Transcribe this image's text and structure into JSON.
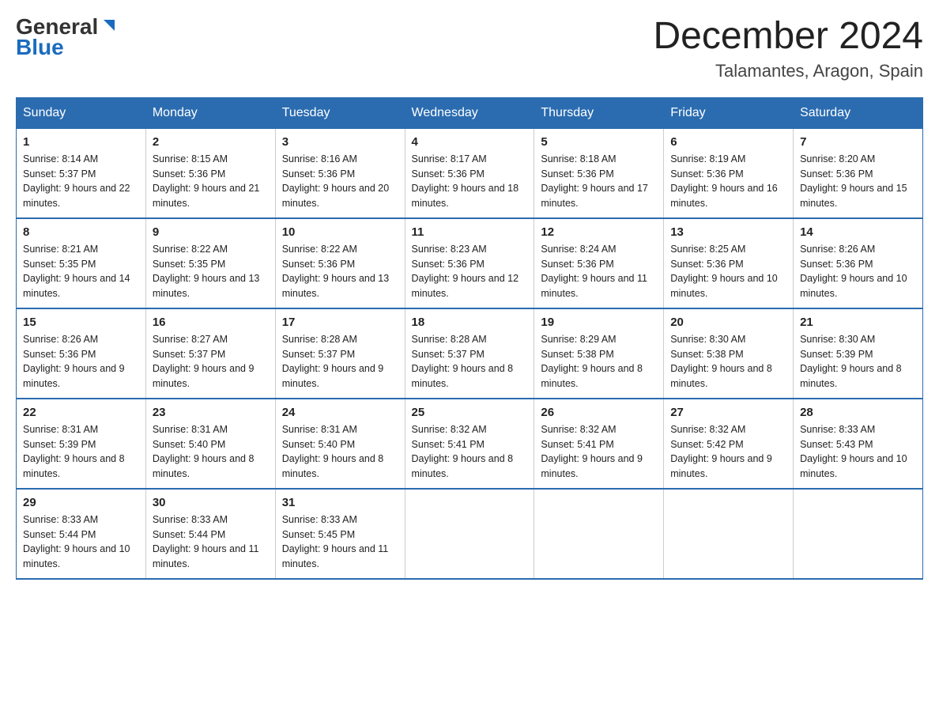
{
  "logo": {
    "part1": "General",
    "part2": "Blue"
  },
  "header": {
    "month": "December 2024",
    "location": "Talamantes, Aragon, Spain"
  },
  "weekdays": [
    "Sunday",
    "Monday",
    "Tuesday",
    "Wednesday",
    "Thursday",
    "Friday",
    "Saturday"
  ],
  "weeks": [
    [
      {
        "day": "1",
        "sunrise": "8:14 AM",
        "sunset": "5:37 PM",
        "daylight": "9 hours and 22 minutes."
      },
      {
        "day": "2",
        "sunrise": "8:15 AM",
        "sunset": "5:36 PM",
        "daylight": "9 hours and 21 minutes."
      },
      {
        "day": "3",
        "sunrise": "8:16 AM",
        "sunset": "5:36 PM",
        "daylight": "9 hours and 20 minutes."
      },
      {
        "day": "4",
        "sunrise": "8:17 AM",
        "sunset": "5:36 PM",
        "daylight": "9 hours and 18 minutes."
      },
      {
        "day": "5",
        "sunrise": "8:18 AM",
        "sunset": "5:36 PM",
        "daylight": "9 hours and 17 minutes."
      },
      {
        "day": "6",
        "sunrise": "8:19 AM",
        "sunset": "5:36 PM",
        "daylight": "9 hours and 16 minutes."
      },
      {
        "day": "7",
        "sunrise": "8:20 AM",
        "sunset": "5:36 PM",
        "daylight": "9 hours and 15 minutes."
      }
    ],
    [
      {
        "day": "8",
        "sunrise": "8:21 AM",
        "sunset": "5:35 PM",
        "daylight": "9 hours and 14 minutes."
      },
      {
        "day": "9",
        "sunrise": "8:22 AM",
        "sunset": "5:35 PM",
        "daylight": "9 hours and 13 minutes."
      },
      {
        "day": "10",
        "sunrise": "8:22 AM",
        "sunset": "5:36 PM",
        "daylight": "9 hours and 13 minutes."
      },
      {
        "day": "11",
        "sunrise": "8:23 AM",
        "sunset": "5:36 PM",
        "daylight": "9 hours and 12 minutes."
      },
      {
        "day": "12",
        "sunrise": "8:24 AM",
        "sunset": "5:36 PM",
        "daylight": "9 hours and 11 minutes."
      },
      {
        "day": "13",
        "sunrise": "8:25 AM",
        "sunset": "5:36 PM",
        "daylight": "9 hours and 10 minutes."
      },
      {
        "day": "14",
        "sunrise": "8:26 AM",
        "sunset": "5:36 PM",
        "daylight": "9 hours and 10 minutes."
      }
    ],
    [
      {
        "day": "15",
        "sunrise": "8:26 AM",
        "sunset": "5:36 PM",
        "daylight": "9 hours and 9 minutes."
      },
      {
        "day": "16",
        "sunrise": "8:27 AM",
        "sunset": "5:37 PM",
        "daylight": "9 hours and 9 minutes."
      },
      {
        "day": "17",
        "sunrise": "8:28 AM",
        "sunset": "5:37 PM",
        "daylight": "9 hours and 9 minutes."
      },
      {
        "day": "18",
        "sunrise": "8:28 AM",
        "sunset": "5:37 PM",
        "daylight": "9 hours and 8 minutes."
      },
      {
        "day": "19",
        "sunrise": "8:29 AM",
        "sunset": "5:38 PM",
        "daylight": "9 hours and 8 minutes."
      },
      {
        "day": "20",
        "sunrise": "8:30 AM",
        "sunset": "5:38 PM",
        "daylight": "9 hours and 8 minutes."
      },
      {
        "day": "21",
        "sunrise": "8:30 AM",
        "sunset": "5:39 PM",
        "daylight": "9 hours and 8 minutes."
      }
    ],
    [
      {
        "day": "22",
        "sunrise": "8:31 AM",
        "sunset": "5:39 PM",
        "daylight": "9 hours and 8 minutes."
      },
      {
        "day": "23",
        "sunrise": "8:31 AM",
        "sunset": "5:40 PM",
        "daylight": "9 hours and 8 minutes."
      },
      {
        "day": "24",
        "sunrise": "8:31 AM",
        "sunset": "5:40 PM",
        "daylight": "9 hours and 8 minutes."
      },
      {
        "day": "25",
        "sunrise": "8:32 AM",
        "sunset": "5:41 PM",
        "daylight": "9 hours and 8 minutes."
      },
      {
        "day": "26",
        "sunrise": "8:32 AM",
        "sunset": "5:41 PM",
        "daylight": "9 hours and 9 minutes."
      },
      {
        "day": "27",
        "sunrise": "8:32 AM",
        "sunset": "5:42 PM",
        "daylight": "9 hours and 9 minutes."
      },
      {
        "day": "28",
        "sunrise": "8:33 AM",
        "sunset": "5:43 PM",
        "daylight": "9 hours and 10 minutes."
      }
    ],
    [
      {
        "day": "29",
        "sunrise": "8:33 AM",
        "sunset": "5:44 PM",
        "daylight": "9 hours and 10 minutes."
      },
      {
        "day": "30",
        "sunrise": "8:33 AM",
        "sunset": "5:44 PM",
        "daylight": "9 hours and 11 minutes."
      },
      {
        "day": "31",
        "sunrise": "8:33 AM",
        "sunset": "5:45 PM",
        "daylight": "9 hours and 11 minutes."
      },
      null,
      null,
      null,
      null
    ]
  ]
}
